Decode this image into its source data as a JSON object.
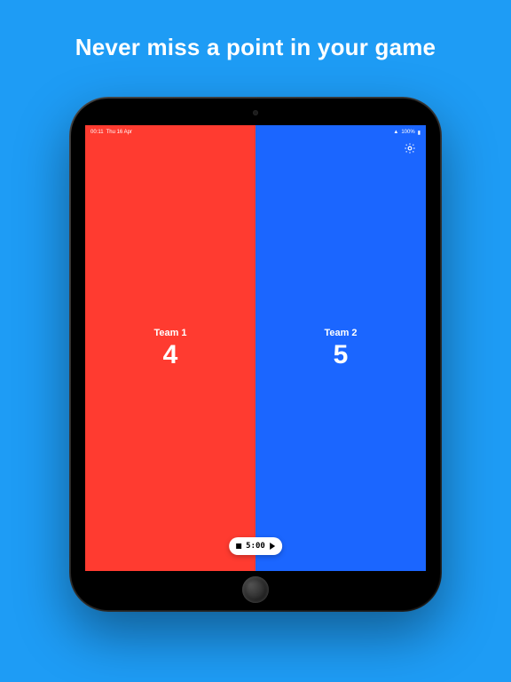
{
  "headline": "Never miss a point in your game",
  "status": {
    "time": "00:11",
    "date": "Thu 16 Apr",
    "battery": "100%"
  },
  "teams": {
    "left": {
      "label": "Team 1",
      "score": "4"
    },
    "right": {
      "label": "Team 2",
      "score": "5"
    }
  },
  "colors": {
    "background": "#1e9cf5",
    "team_left": "#ff3b30",
    "team_right": "#1b66ff"
  },
  "timer": {
    "value": "5:00"
  },
  "icons": {
    "settings": "gear-icon",
    "stop": "stop-icon",
    "play": "play-icon",
    "wifi": "wifi-icon",
    "battery": "battery-icon"
  }
}
